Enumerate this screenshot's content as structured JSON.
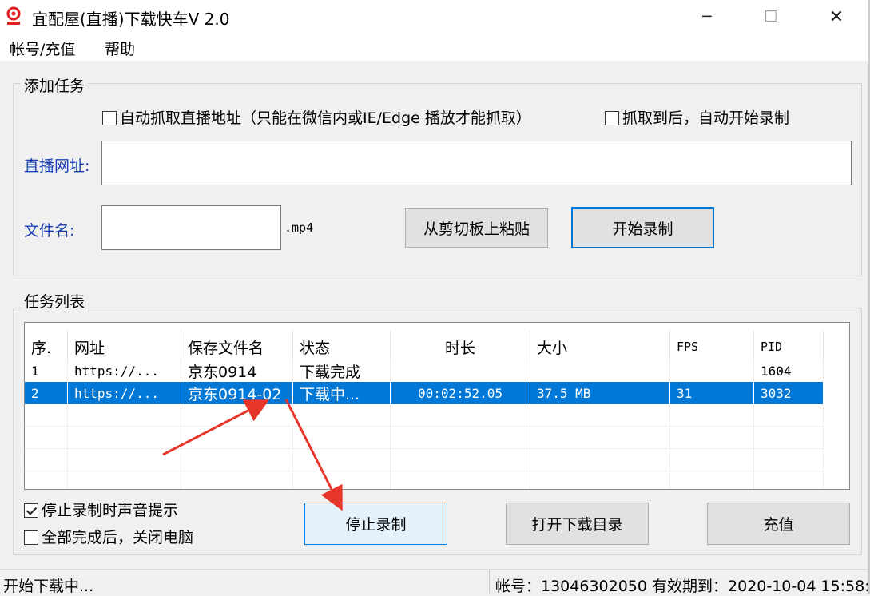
{
  "window": {
    "title": "宜配屋(直播)下载快车V 2.0",
    "minimize_glyph": "─",
    "maximize_glyph": "☐",
    "close_glyph": "✕"
  },
  "menu": {
    "items": [
      "帐号/充值",
      "帮助"
    ]
  },
  "add_task": {
    "group_title": "添加任务",
    "auto_capture_label": "自动抓取直播地址（只能在微信内或IE/Edge 播放才能抓取）",
    "auto_capture_checked": false,
    "auto_start_label": "抓取到后，自动开始录制",
    "auto_start_checked": false,
    "url_label": "直播网址:",
    "url_value": "",
    "filename_label": "文件名:",
    "filename_value": "",
    "extension": ".mp4",
    "paste_button": "从剪切板上粘贴",
    "start_button": "开始录制"
  },
  "task_list": {
    "group_title": "任务列表",
    "columns": [
      "序.",
      "网址",
      "保存文件名",
      "状态",
      "时长",
      "大小",
      "FPS",
      "PID"
    ],
    "rows": [
      {
        "index": "1",
        "url": "https://...",
        "filename": "京东0914",
        "status": "下载完成",
        "duration": "",
        "size": "",
        "fps": "",
        "pid": "1604",
        "selected": false
      },
      {
        "index": "2",
        "url": "https://...",
        "filename": "京东0914-02",
        "status": "下载中...",
        "duration": "00:02:52.05",
        "size": "37.5 MB",
        "fps": "31",
        "pid": "3032",
        "selected": true
      }
    ]
  },
  "options": {
    "beep_label": "停止录制时声音提示",
    "beep_checked": true,
    "shutdown_label": "全部完成后，关闭电脑",
    "shutdown_checked": false
  },
  "buttons": {
    "stop": "停止录制",
    "open_dir": "打开下载目录",
    "recharge": "充值"
  },
  "status": {
    "left": "开始下载中...",
    "right": "帐号：13046302050 有效期到：2020-10-04 15:58:"
  },
  "colors": {
    "selection": "#0078d7",
    "label_blue": "#1a3fb5",
    "annotation_arrow": "#e8352a"
  }
}
